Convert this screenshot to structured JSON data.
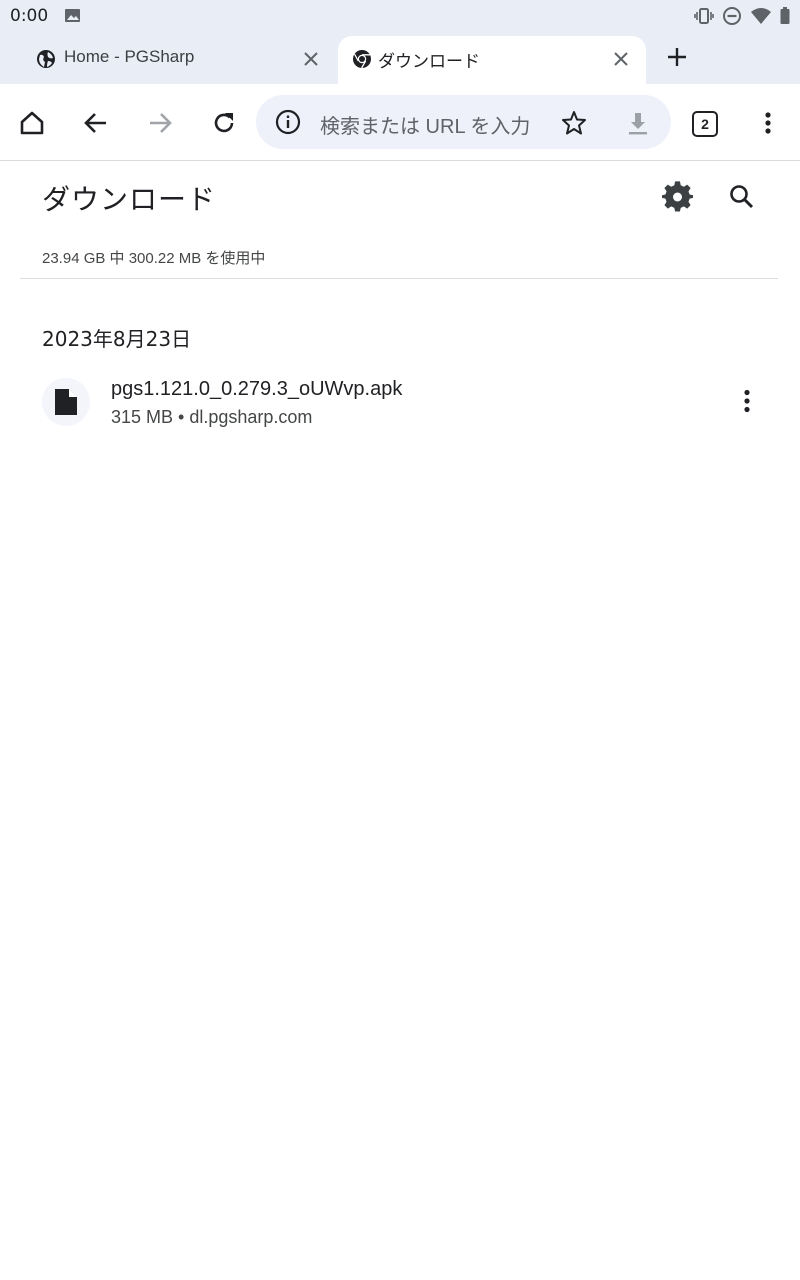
{
  "status_bar": {
    "time": "0:00",
    "icons": [
      "gallery-icon",
      "vibrate-icon",
      "dnd-icon",
      "wifi-icon",
      "battery-icon"
    ]
  },
  "tabs": [
    {
      "title": "Home - PGSharp",
      "favicon": "globe-icon",
      "active": false
    },
    {
      "title": "ダウンロード",
      "favicon": "chrome-icon",
      "active": true
    }
  ],
  "toolbar": {
    "omnibox_placeholder": "検索または URL を入力",
    "tab_count": "2"
  },
  "page": {
    "title": "ダウンロード",
    "storage_text": "23.94 GB 中 300.22 MB を使用中"
  },
  "downloads": {
    "date_header": "2023年8月23日",
    "items": [
      {
        "name": "pgs1.121.0_0.279.3_oUWvp.apk",
        "meta": "315 MB • dl.pgsharp.com"
      }
    ]
  },
  "colors": {
    "chrome_bg": "#e9edf6",
    "omnibox_bg": "#eef1f9",
    "text_primary": "#202124",
    "text_secondary": "#444746"
  }
}
